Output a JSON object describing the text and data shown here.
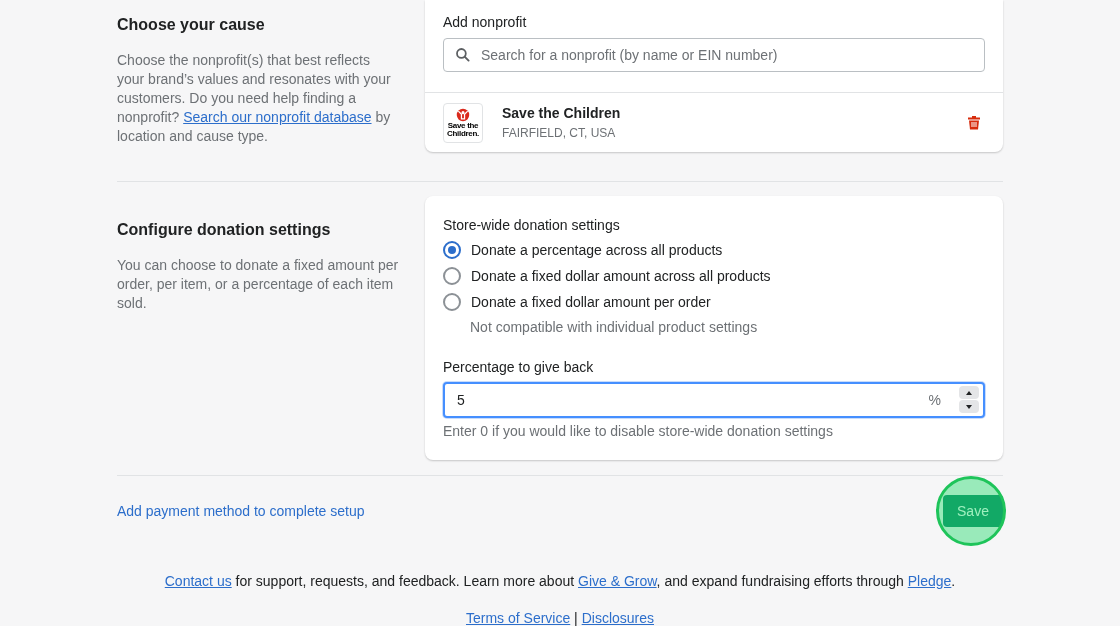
{
  "cause_section": {
    "title": "Choose your cause",
    "description": [
      {
        "kind": "text",
        "text": "Choose the nonprofit(s) that best reflects your brand’s values and resonates with your customers. Do you need help finding a nonprofit? "
      },
      {
        "kind": "link",
        "text": "Search our nonprofit database"
      },
      {
        "kind": "text",
        "text": " by location and cause type."
      }
    ],
    "card": {
      "label": "Add nonprofit",
      "search": {
        "placeholder": "Search for a nonprofit (by name or EIN number)"
      },
      "nonprofits": [
        {
          "logo_text": "Save the Children.",
          "name": "Save the Children",
          "location": "FAIRFIELD, CT, USA"
        }
      ]
    }
  },
  "donation_section": {
    "title": "Configure donation settings",
    "description": "You can choose to donate a fixed amount per order, per item, or a percentage of each item sold.",
    "card": {
      "label": "Store-wide donation settings",
      "options": [
        {
          "label": "Donate a percentage across all products",
          "selected": true
        },
        {
          "label": "Donate a fixed dollar amount across all products",
          "selected": false
        },
        {
          "label": "Donate a fixed dollar amount per order",
          "selected": false,
          "help": "Not compatible with individual product settings"
        }
      ],
      "percentage": {
        "label": "Percentage to give back",
        "value": "5",
        "suffix": "%",
        "focused": true,
        "help": "Enter 0 if you would like to disable store-wide donation settings"
      }
    }
  },
  "footer_bar": {
    "link": "Add payment method to complete setup",
    "save_button": "Save",
    "save_highlighted": true
  },
  "footer": {
    "lines": [
      [
        {
          "kind": "link",
          "text": "Contact us"
        },
        {
          "kind": "text",
          "text": " for support, requests, and feedback. Learn more about "
        },
        {
          "kind": "link",
          "text": "Give & Grow"
        },
        {
          "kind": "text",
          "text": ", and expand fundraising efforts through "
        },
        {
          "kind": "link",
          "text": "Pledge"
        },
        {
          "kind": "text",
          "text": "."
        }
      ],
      [
        {
          "kind": "link",
          "text": "Terms of Service"
        },
        {
          "kind": "text",
          "text": " | "
        },
        {
          "kind": "link",
          "text": "Disclosures"
        }
      ]
    ]
  }
}
